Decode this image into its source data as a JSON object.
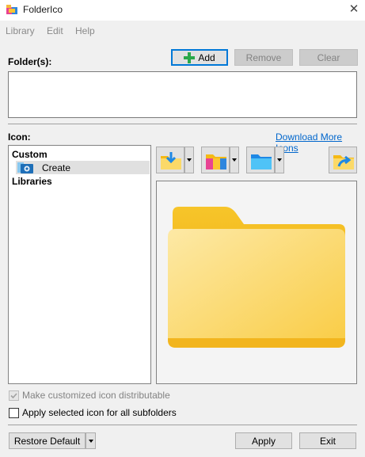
{
  "window": {
    "title": "FolderIco",
    "close_glyph": "✕"
  },
  "menu": {
    "items": [
      {
        "label": "Library"
      },
      {
        "label": "Edit"
      },
      {
        "label": "Help"
      }
    ]
  },
  "folders": {
    "label": "Folder(s):",
    "add_label": "Add",
    "remove_label": "Remove",
    "clear_label": "Clear",
    "list_value": ""
  },
  "icon": {
    "label": "Icon:",
    "download_link": "Download More Icons"
  },
  "tree": {
    "custom_label": "Custom",
    "create_label": "Create",
    "libraries_label": "Libraries"
  },
  "options": {
    "distributable_label": "Make customized icon distributable",
    "distributable_checked": true,
    "distributable_enabled": false,
    "subfolders_label": "Apply selected icon for all subfolders",
    "subfolders_checked": false
  },
  "footer": {
    "restore_label": "Restore Default",
    "apply_label": "Apply",
    "exit_label": "Exit"
  },
  "colors": {
    "accent_blue": "#0078d7",
    "link": "#0066cc",
    "folder_back": "#f5b914",
    "folder_front": "#fbd968",
    "add_green": "#2aa84a"
  }
}
